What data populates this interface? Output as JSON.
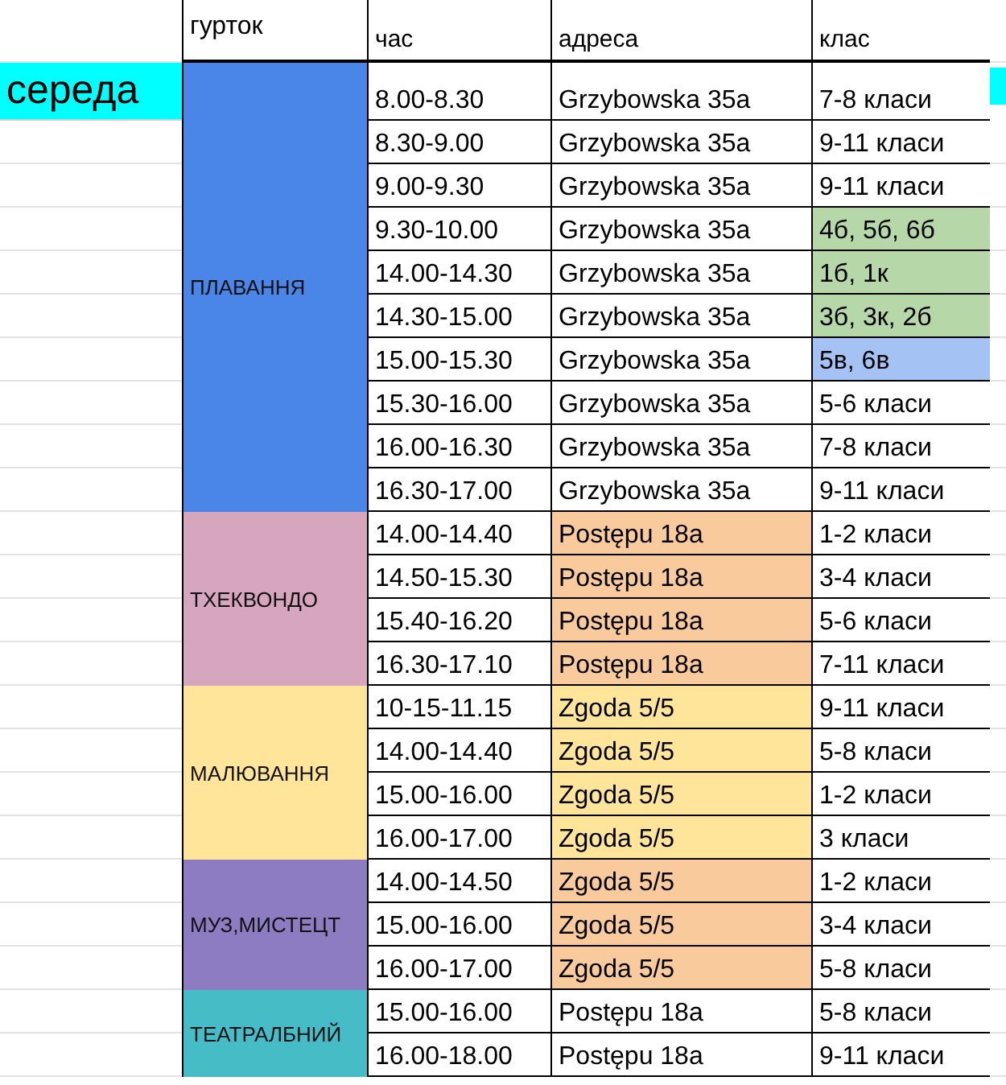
{
  "day": "середа",
  "headers": [
    "гурток",
    "час",
    "адреса",
    "клас"
  ],
  "groups": [
    {
      "name": "ПЛАВАННЯ",
      "color": "#4a86e8",
      "sessions": [
        {
          "time": "8.00-8.30",
          "address": {
            "text": "Grzybowska 35a"
          },
          "klass": {
            "text": "7-8 класи"
          }
        },
        {
          "time": "8.30-9.00",
          "address": {
            "text": "Grzybowska 35a"
          },
          "klass": {
            "text": "9-11 класи"
          }
        },
        {
          "time": "9.00-9.30",
          "address": {
            "text": "Grzybowska 35a"
          },
          "klass": {
            "text": "9-11 класи"
          }
        },
        {
          "time": "9.30-10.00",
          "address": {
            "text": "Grzybowska 35a"
          },
          "klass": {
            "text": "4б, 5б, 6б",
            "color": "#b6d7a8"
          }
        },
        {
          "time": "14.00-14.30",
          "address": {
            "text": "Grzybowska 35a"
          },
          "klass": {
            "text": "1б, 1к",
            "color": "#b6d7a8"
          }
        },
        {
          "time": "14.30-15.00",
          "address": {
            "text": "Grzybowska 35a"
          },
          "klass": {
            "text": "3б, 3к, 2б",
            "color": "#b6d7a8"
          }
        },
        {
          "time": "15.00-15.30",
          "address": {
            "text": "Grzybowska 35a"
          },
          "klass": {
            "text": "5в, 6в",
            "color": "#a4c2f4"
          }
        },
        {
          "time": "15.30-16.00",
          "address": {
            "text": "Grzybowska 35a"
          },
          "klass": {
            "text": "5-6 класи"
          }
        },
        {
          "time": "16.00-16.30",
          "address": {
            "text": "Grzybowska 35a"
          },
          "klass": {
            "text": "7-8 класи"
          }
        },
        {
          "time": "16.30-17.00",
          "address": {
            "text": "Grzybowska 35a"
          },
          "klass": {
            "text": "9-11 класи"
          }
        }
      ]
    },
    {
      "name": "ТХЕКВОНДО",
      "color": "#d5a6bd",
      "sessions": [
        {
          "time": "14.00-14.40",
          "address": {
            "text": "Postępu 18a",
            "color": "#f9cb9c"
          },
          "klass": {
            "text": "1-2 класи"
          }
        },
        {
          "time": "14.50-15.30",
          "address": {
            "text": "Postępu 18a",
            "color": "#f9cb9c"
          },
          "klass": {
            "text": "3-4 класи"
          }
        },
        {
          "time": "15.40-16.20",
          "address": {
            "text": "Postępu 18a",
            "color": "#f9cb9c"
          },
          "klass": {
            "text": "5-6 класи"
          }
        },
        {
          "time": "16.30-17.10",
          "address": {
            "text": "Postępu 18a",
            "color": "#f9cb9c"
          },
          "klass": {
            "text": "7-11 класи"
          }
        }
      ]
    },
    {
      "name": "МАЛЮВАННЯ",
      "color": "#ffe599",
      "sessions": [
        {
          "time": "10-15-11.15",
          "address": {
            "text": "Zgoda 5/5",
            "color": "#ffe599"
          },
          "klass": {
            "text": "9-11 класи"
          }
        },
        {
          "time": "14.00-14.40",
          "address": {
            "text": "Zgoda 5/5",
            "color": "#ffe599"
          },
          "klass": {
            "text": "5-8 класи"
          }
        },
        {
          "time": "15.00-16.00",
          "address": {
            "text": "Zgoda 5/5",
            "color": "#ffe599"
          },
          "klass": {
            "text": "1-2 класи"
          }
        },
        {
          "time": "16.00-17.00",
          "address": {
            "text": "Zgoda 5/5",
            "color": "#ffe599"
          },
          "klass": {
            "text": "3 класи"
          }
        }
      ]
    },
    {
      "name": "МУЗ,МИСТЕЦТ",
      "color": "#8e7cc3",
      "sessions": [
        {
          "time": "14.00-14.50",
          "address": {
            "text": "Zgoda 5/5",
            "color": "#f9cb9c"
          },
          "klass": {
            "text": "1-2 класи"
          }
        },
        {
          "time": "15.00-16.00",
          "address": {
            "text": "Zgoda 5/5",
            "color": "#f9cb9c"
          },
          "klass": {
            "text": "3-4 класи"
          }
        },
        {
          "time": "16.00-17.00",
          "address": {
            "text": "Zgoda 5/5",
            "color": "#f9cb9c"
          },
          "klass": {
            "text": "5-8 класи"
          }
        }
      ]
    },
    {
      "name": "ТЕАТРАЛБНИЙ",
      "color": "#46bdc6",
      "sessions": [
        {
          "time": "15.00-16.00",
          "address": {
            "text": "Postępu 18a"
          },
          "klass": {
            "text": "5-8 класи"
          }
        },
        {
          "time": "16.00-18.00",
          "address": {
            "text": "Postępu 18a"
          },
          "klass": {
            "text": "9-11 класи"
          }
        }
      ]
    }
  ]
}
